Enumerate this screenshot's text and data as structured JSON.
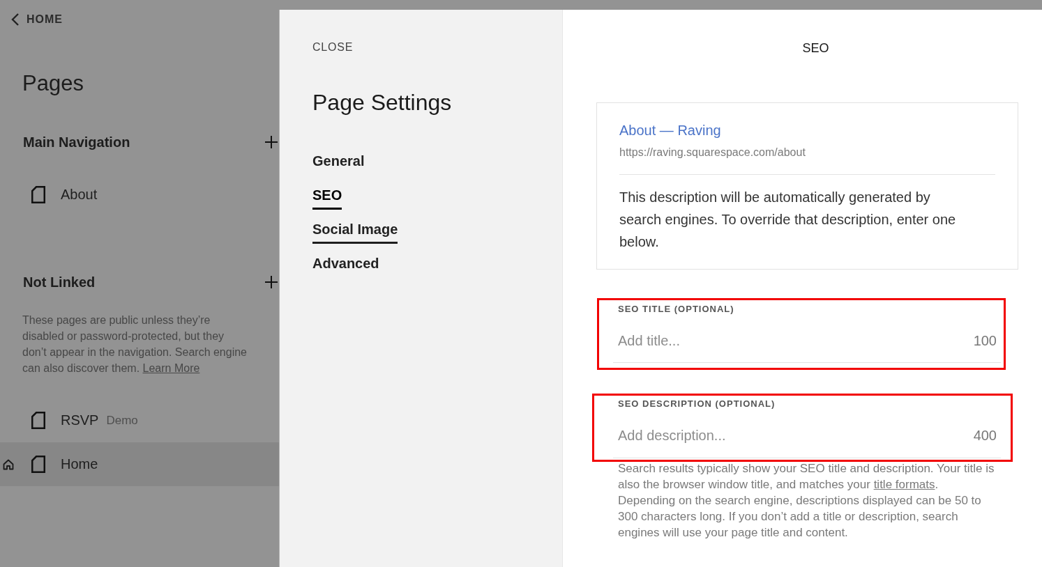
{
  "sidebar": {
    "back_link": "HOME",
    "title": "Pages",
    "sections": [
      {
        "heading": "Main Navigation",
        "items": [
          {
            "label": "About",
            "selected": false,
            "homepage": false
          }
        ]
      },
      {
        "heading": "Not Linked",
        "description": "These pages are public unless they’re disabled or password-protected, but they don’t appear in the navigation. Search engine can also discover them.",
        "link": "Learn More",
        "items": [
          {
            "label": "RSVP",
            "tag": "Demo",
            "selected": false,
            "homepage": false
          },
          {
            "label": "Home",
            "selected": true,
            "homepage": true
          }
        ]
      }
    ]
  },
  "settings": {
    "close": "CLOSE",
    "title": "Page Settings",
    "nav": [
      {
        "label": "General",
        "selected": false,
        "hovered": false
      },
      {
        "label": "SEO",
        "selected": true,
        "hovered": false
      },
      {
        "label": "Social Image",
        "selected": false,
        "hovered": true
      },
      {
        "label": "Advanced",
        "selected": false,
        "hovered": false
      }
    ]
  },
  "content": {
    "title": "SEO",
    "preview": {
      "title": "About — Raving",
      "url": "https://raving.squarespace.com/about",
      "description": "This description will be automatically generated by search engines. To override that description, enter one below."
    },
    "fields": [
      {
        "label": "SEO TITLE (OPTIONAL)",
        "placeholder": "Add title...",
        "counter": "100",
        "highlighted": true
      },
      {
        "label": "SEO DESCRIPTION (OPTIONAL)",
        "placeholder": "Add description...",
        "counter": "400",
        "highlighted": true
      }
    ],
    "help": [
      {
        "kind": "text",
        "text": "Search results typically show your SEO title and description. Your title is also the browser window title, and matches your "
      },
      {
        "kind": "link",
        "text": "title formats"
      },
      {
        "kind": "text",
        "text": ". Depending on the search engine, descriptions displayed can be 50 to 300 characters long. If you don’t add a title or description, search engines will use your page title and content."
      }
    ]
  }
}
